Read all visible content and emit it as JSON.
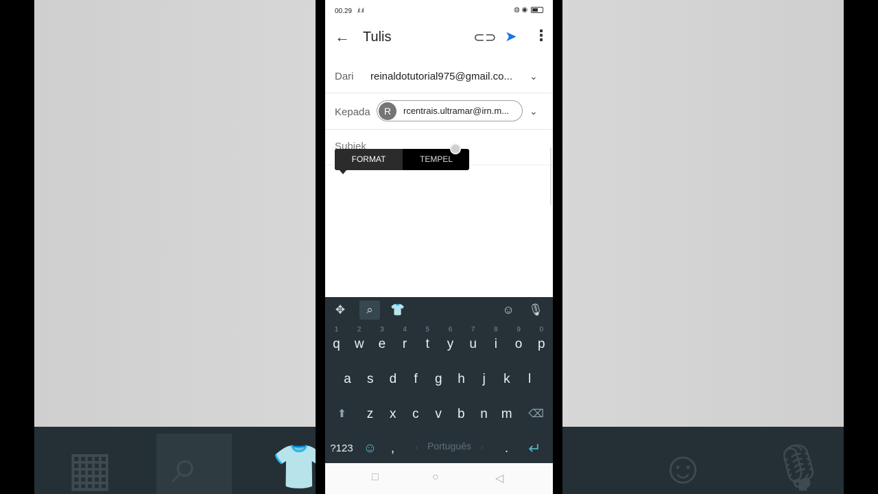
{
  "status_bar": {
    "time": "00.29",
    "signal": ".ıl .ıl",
    "right_icons": "◍ ◉"
  },
  "app_bar": {
    "title": "Tulis",
    "back_icon": "arrow-left-icon",
    "attach_icon": "paperclip-icon",
    "send_icon": "send-icon",
    "more_icon": "more-vert-icon"
  },
  "compose": {
    "from_label": "Dari",
    "from_value": "reinaldotutorial975@gmail.co...",
    "to_label": "Kepada",
    "to_avatar_letter": "R",
    "to_value": "rcentrais.ultramar@irn.m...",
    "subject_label": "Subjek"
  },
  "popup_menu": {
    "format_label": "FORMAT",
    "paste_label": "TEMPEL"
  },
  "keyboard": {
    "toolbar_icons": [
      "apps-icon",
      "search-icon",
      "theme-shirt-icon",
      "sticker-icon",
      "mic-icon"
    ],
    "row1": [
      [
        "q",
        "1"
      ],
      [
        "w",
        "2"
      ],
      [
        "e",
        "3"
      ],
      [
        "r",
        "4"
      ],
      [
        "t",
        "5"
      ],
      [
        "y",
        "6"
      ],
      [
        "u",
        "7"
      ],
      [
        "i",
        "8"
      ],
      [
        "o",
        "9"
      ],
      [
        "p",
        "0"
      ]
    ],
    "row2": [
      "a",
      "s",
      "d",
      "f",
      "g",
      "h",
      "j",
      "k",
      "l"
    ],
    "row3": [
      "z",
      "x",
      "c",
      "v",
      "b",
      "n",
      "m"
    ],
    "symbols_label": "?123",
    "comma": ",",
    "space_label": "Português",
    "period": ".",
    "accent_color": "#4fb5c4",
    "background_color": "#263238"
  },
  "nav_bar": {
    "icons": [
      "recents-square-icon",
      "home-circle-icon",
      "back-triangle-icon"
    ]
  }
}
